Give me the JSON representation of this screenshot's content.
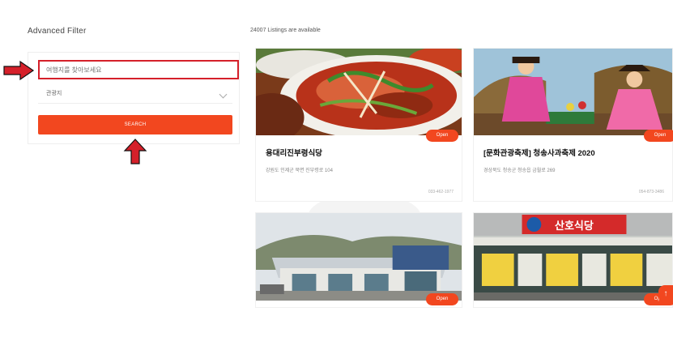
{
  "filter": {
    "title": "Advanced Filter",
    "search_placeholder": "여행지를 찾아보세요",
    "category_value": "관광지",
    "search_label": "SEARCH"
  },
  "listings": {
    "count_label": "24007 Listings are available",
    "cards": [
      {
        "title": "용대리진부령식당",
        "address": "강원도 인제군 북면 진부령로 104",
        "phone": "033-462-1977",
        "status": "Open"
      },
      {
        "title": "[문화관광축제] 청송사과축제 2020",
        "address": "경상북도 청송군 청송읍 금월로 269",
        "phone": "054-873-3486",
        "status": "Open"
      },
      {
        "title": "",
        "address": "",
        "phone": "",
        "status": "Open"
      },
      {
        "title": "",
        "address": "",
        "phone": "",
        "status": "Open"
      }
    ],
    "sign_text": "산호식당"
  },
  "colors": {
    "accent": "#f2471f",
    "annotation": "#d5202a"
  }
}
